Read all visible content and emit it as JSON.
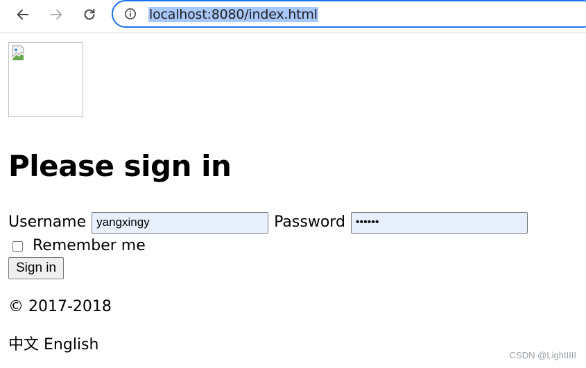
{
  "browser": {
    "url": "localhost:8080/index.html",
    "accent_color": "#1a73e8",
    "icons": {
      "back": "arrow-left-icon",
      "forward": "arrow-right-icon",
      "reload": "reload-icon",
      "site_info": "info-icon"
    }
  },
  "page": {
    "logo_icon": "broken-image-icon",
    "heading": "Please sign in",
    "form": {
      "username_label": "Username",
      "username_value": "yangxingy",
      "password_label": "Password",
      "password_value": "••••••",
      "remember_label": "Remember me",
      "remember_checked": false,
      "signin_label": "Sign in"
    },
    "footer": {
      "copyright": "© 2017-2018",
      "lang_chinese": "中文",
      "lang_english": "English"
    }
  },
  "watermark": "CSDN @LightIIII"
}
